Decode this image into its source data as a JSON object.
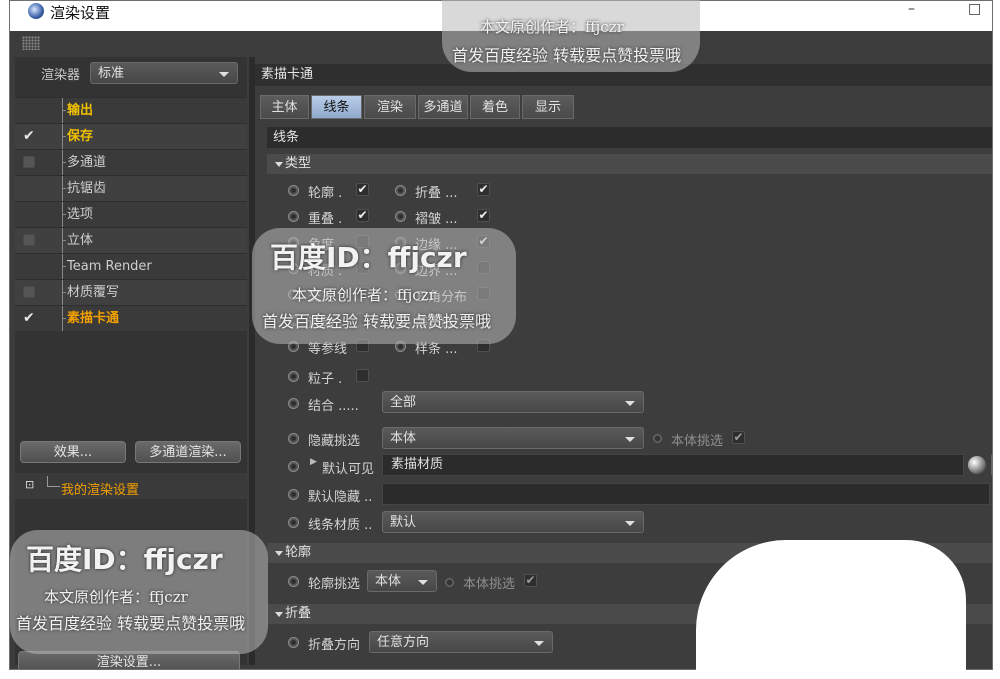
{
  "window": {
    "title": "渲染设置",
    "minimize": "–",
    "maximize": "□"
  },
  "left": {
    "renderer_label": "渲染器",
    "renderer_value": "标准",
    "tree": [
      {
        "label": "输出",
        "check": "none",
        "style": "yellow"
      },
      {
        "label": "保存",
        "check": "tick",
        "style": "yellow"
      },
      {
        "label": "多通道",
        "check": "box",
        "style": "normal"
      },
      {
        "label": "抗锯齿",
        "check": "none",
        "style": "normal"
      },
      {
        "label": "选项",
        "check": "none",
        "style": "normal"
      },
      {
        "label": "立体",
        "check": "box",
        "style": "normal"
      },
      {
        "label": "Team Render",
        "check": "none",
        "style": "normal"
      },
      {
        "label": "材质覆写",
        "check": "box",
        "style": "normal"
      },
      {
        "label": "素描卡通",
        "check": "tick",
        "style": "orange"
      }
    ],
    "effects_button": "效果...",
    "multipass_button": "多通道渲染...",
    "preset_label": "我的渲染设置",
    "render_settings_button": "渲染设置..."
  },
  "right": {
    "header": "素描卡通",
    "tabs": [
      {
        "label": "主体",
        "active": false
      },
      {
        "label": "线条",
        "active": true
      },
      {
        "label": "渲染",
        "active": false
      },
      {
        "label": "多通道",
        "active": false
      },
      {
        "label": "着色",
        "active": false
      },
      {
        "label": "显示",
        "active": false
      }
    ],
    "section_title": "线条",
    "type_group": "类型",
    "type_rows": [
      [
        {
          "label": "轮廓",
          "dots": ".",
          "checked": true
        },
        {
          "label": "折叠",
          "dots": "...",
          "checked": true
        }
      ],
      [
        {
          "label": "重叠",
          "dots": ".",
          "checked": true
        },
        {
          "label": "褶皱",
          "dots": "...",
          "checked": true
        }
      ],
      [
        {
          "label": "角度",
          "dots": ".",
          "checked": false
        },
        {
          "label": "边缘",
          "dots": "...",
          "checked": true
        }
      ],
      [
        {
          "label": "材质",
          "dots": ".",
          "checked": false
        },
        {
          "label": "边界",
          "dots": "...",
          "checked": false
        }
      ],
      [
        {
          "label": "交叉",
          "dots": ".",
          "checked": false
        },
        {
          "label": "三角分布",
          "dots": "",
          "checked": false
        }
      ],
      [
        {
          "label": "运动",
          "dots": ".",
          "checked": false
        },
        {
          "label": "等高线",
          "dots": "",
          "checked": false
        }
      ],
      [
        {
          "label": "等参线",
          "dots": "",
          "checked": false
        },
        {
          "label": "样条",
          "dots": "...",
          "checked": false
        }
      ]
    ],
    "particles": {
      "label": "粒子",
      "dots": ".",
      "checked": false
    },
    "combine": {
      "label": "结合",
      "dots": ".....",
      "value": "全部"
    },
    "hidden_filter": {
      "label": "隐藏挑选",
      "value": "本体",
      "extra_label": "本体挑选",
      "extra_checked": true
    },
    "default_visible": {
      "label": "默认可见",
      "value": "素描材质"
    },
    "default_hidden": {
      "label": "默认隐藏",
      "value": ""
    },
    "line_material": {
      "label": "线条材质",
      "value": "默认"
    },
    "outline_group": "轮廓",
    "outline_filter": {
      "label": "轮廓挑选",
      "value": "本体",
      "extra_label": "本体挑选",
      "extra_checked": true
    },
    "fold_group": "折叠",
    "fold_direction": {
      "label": "折叠方向",
      "value": "任意方向"
    }
  },
  "watermark": {
    "id_text": "百度ID：ffjczr",
    "author": "本文原创作者：ffjczr",
    "note": "首发百度经验 转载要点赞投票哦"
  },
  "colors": {
    "active_tab": "#a6bedd",
    "highlight_yellow": "#f0c000",
    "highlight_orange": "#f4a000"
  }
}
